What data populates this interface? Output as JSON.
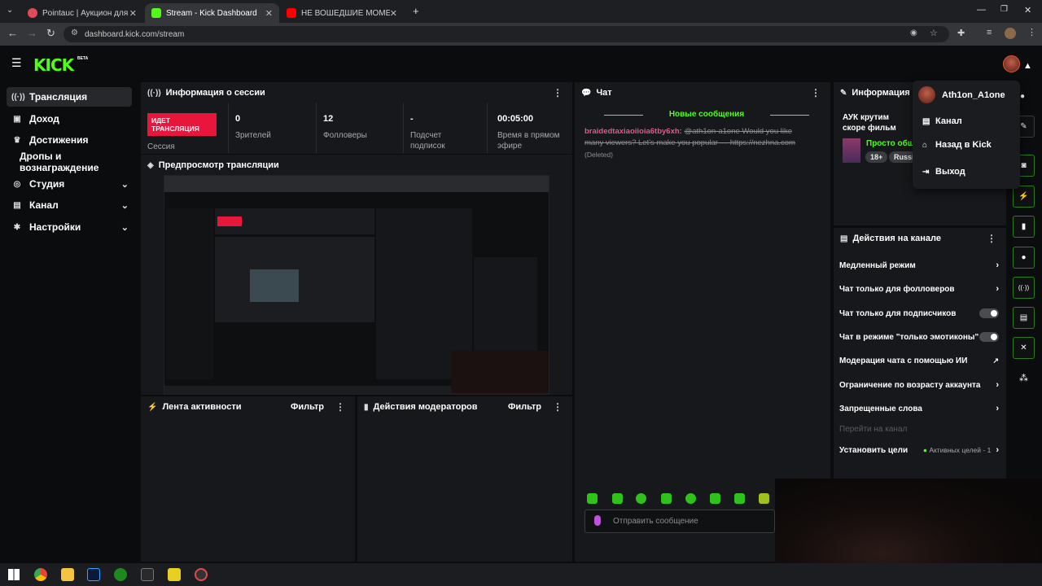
{
  "browser": {
    "tabs": [
      {
        "title": "Pointauc | Аукцион для стримеров",
        "active": false,
        "color": "#e04a5a"
      },
      {
        "title": "Stream - Kick Dashboard",
        "active": true,
        "color": "#53fc18"
      },
      {
        "title": "НЕ ВОШЕДШИЕ МОМЕНТЫ ДЕНЬ",
        "active": false,
        "color": "#ff0000"
      }
    ],
    "url": "dashboard.kick.com/stream"
  },
  "brand": {
    "logo": "KICK",
    "badge": "BETA",
    "accent": "#53fc18"
  },
  "sidebar": {
    "items": [
      {
        "label": "Трансляция",
        "icon": "broadcast-icon",
        "glyph": "((·))",
        "active": true,
        "chevron": false
      },
      {
        "label": "Доход",
        "icon": "wallet-icon",
        "glyph": "▣",
        "active": false,
        "chevron": false
      },
      {
        "label": "Достижения",
        "icon": "trophy-icon",
        "glyph": "♛",
        "active": false,
        "chevron": false
      },
      {
        "label": "Дропы и вознаграждение",
        "icon": "",
        "glyph": "",
        "active": false,
        "chevron": false
      },
      {
        "label": "Студия",
        "icon": "studio-icon",
        "glyph": "◎",
        "active": false,
        "chevron": true
      },
      {
        "label": "Канал",
        "icon": "channel-icon",
        "glyph": "▤",
        "active": false,
        "chevron": true
      },
      {
        "label": "Настройки",
        "icon": "gear-icon",
        "glyph": "✱",
        "active": false,
        "chevron": true
      }
    ]
  },
  "session": {
    "title": "Информация о сессии",
    "live_badge": "ИДЕТ ТРАНСЛЯЦИЯ",
    "live_color": "#e8153d",
    "session_label": "Сессия",
    "stats": [
      {
        "value": "0",
        "label": "Зрителей"
      },
      {
        "value": "12",
        "label": "Фолловеры"
      },
      {
        "value": "-",
        "label": "Подсчет подписок"
      },
      {
        "value": "00:05:00",
        "label": "Время в прямом эфире"
      }
    ]
  },
  "preview": {
    "title": "Предпросмотр трансляции"
  },
  "activity": {
    "title": "Лента активности",
    "filter": "Фильтр"
  },
  "mod_actions": {
    "title": "Действия модераторов",
    "filter": "Фильтр"
  },
  "chat": {
    "title": "Чат",
    "new_messages": "Новые сообщения",
    "message": {
      "user": "braidedtaxiaoiioia6tby6xh:",
      "text": "@ath1on-a1one Would you like many viewers? Let's make you popular — https://nezhna.com",
      "deleted": "(Deleted)"
    },
    "input_placeholder": "Отправить сообщение"
  },
  "stream_info": {
    "title": "Информация о т",
    "stream_title": "АУК крутим скоре фильм",
    "category": "Просто общ",
    "tags": [
      "18+",
      "Russi"
    ]
  },
  "channel_actions": {
    "title": "Действия на канале",
    "rows": [
      {
        "label": "Медленный режим",
        "control": "arrow"
      },
      {
        "label": "Чат только для фолловеров",
        "control": "arrow"
      },
      {
        "label": "Чат только для подписчиков",
        "control": "toggle"
      },
      {
        "label": "Чат в режиме \"только эмотиконы\"",
        "control": "toggle"
      },
      {
        "label": "Модерация чата с помощью ИИ",
        "control": "external"
      },
      {
        "label": "Ограничение по возрасту аккаунта",
        "control": "arrow"
      },
      {
        "label": "Запрещенные слова",
        "control": "arrow"
      }
    ],
    "goto_channel": "Перейти на канал",
    "goals_label": "Установить цели",
    "goals_status": "Активных целей - 1"
  },
  "user_menu": {
    "username": "Ath1on_A1one",
    "items": [
      {
        "label": "Канал",
        "icon": "channel-icon"
      },
      {
        "label": "Назад в Kick",
        "icon": "home-icon"
      },
      {
        "label": "Выход",
        "icon": "logout-icon"
      }
    ]
  }
}
